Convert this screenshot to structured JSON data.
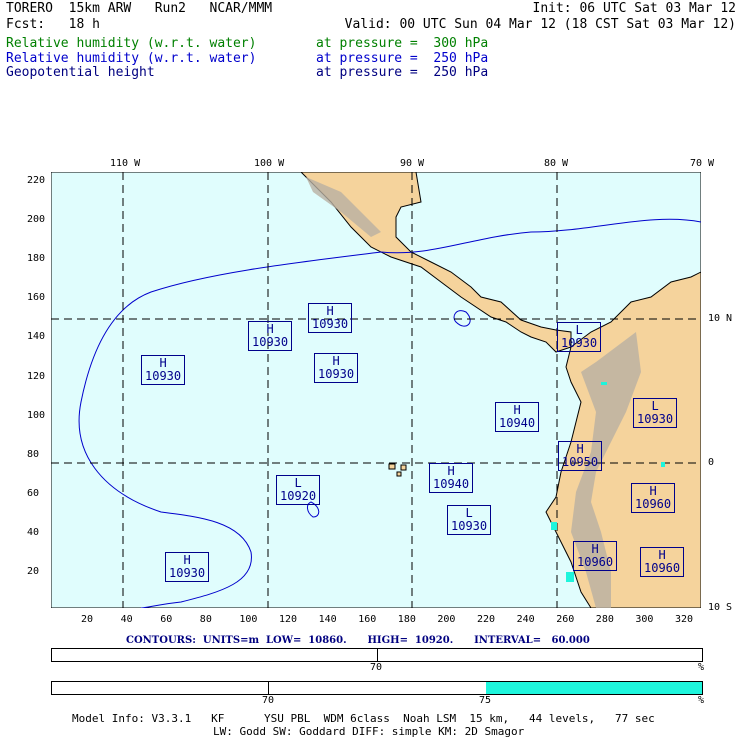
{
  "header": {
    "line1_left": "TORERO  15km ARW   Run2   NCAR/MMM",
    "line1_right": "Init: 06 UTC Sat 03 Mar 12",
    "line2_left": "Fcst:   18 h",
    "line2_right": "Valid: 00 UTC Sun 04 Mar 12 (18 CST Sat 03 Mar 12)"
  },
  "fields": [
    {
      "name": "Relative humidity (w.r.t. water)",
      "level": "at pressure =  300 hPa",
      "color": "#008000"
    },
    {
      "name": "Relative humidity (w.r.t. water)",
      "level": "at pressure =  250 hPa",
      "color": "#0000cc"
    },
    {
      "name": "Geopotential height",
      "level": "at pressure =  250 hPa",
      "color": "#000080"
    }
  ],
  "map": {
    "lon_labels": [
      "110 W",
      "100 W",
      "90 W",
      "80 W",
      "70 W"
    ],
    "lat_labels": [
      "10 N",
      "0",
      "10 S"
    ],
    "x_ticks": [
      "20",
      "40",
      "60",
      "80",
      "100",
      "120",
      "140",
      "160",
      "180",
      "200",
      "220",
      "240",
      "260",
      "280",
      "300",
      "320"
    ],
    "y_ticks": [
      "20",
      "40",
      "60",
      "80",
      "100",
      "120",
      "140",
      "160",
      "180",
      "200",
      "220"
    ],
    "centers": [
      {
        "type": "H",
        "value": "10930"
      },
      {
        "type": "H",
        "value": "10930"
      },
      {
        "type": "H",
        "value": "10930"
      },
      {
        "type": "H",
        "value": "10930"
      },
      {
        "type": "L",
        "value": "10930"
      },
      {
        "type": "H",
        "value": "10940"
      },
      {
        "type": "L",
        "value": "10930"
      },
      {
        "type": "H",
        "value": "10950"
      },
      {
        "type": "H",
        "value": "10940"
      },
      {
        "type": "L",
        "value": "10920"
      },
      {
        "type": "L",
        "value": "10930"
      },
      {
        "type": "H",
        "value": "10960"
      },
      {
        "type": "H",
        "value": "10960"
      },
      {
        "type": "H",
        "value": "10960"
      },
      {
        "type": "H",
        "value": "10930"
      }
    ],
    "colors": {
      "ocean": "#e0fdfd",
      "land": "#f5d39c",
      "mountain": "#b9b0a3",
      "high_rh": "#1ef5dc"
    }
  },
  "contours": "CONTOURS:  UNITS=m  LOW=  10860.      HIGH=  10920.      INTERVAL=   60.000",
  "scale1": {
    "labels": [
      "70",
      "%"
    ]
  },
  "scale2": {
    "labels": [
      "70",
      "75",
      "%"
    ],
    "fill_from_percent": 75
  },
  "footer": {
    "line1": "Model Info: V3.3.1   KF      YSU PBL  WDM 6class  Noah LSM  15 km,   44 levels,   77 sec",
    "line2": "LW: Godd SW: Goddard DIFF: simple KM: 2D Smagor"
  }
}
